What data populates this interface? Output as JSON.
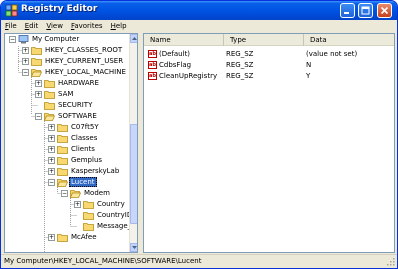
{
  "window": {
    "title": "Registry Editor"
  },
  "menu": {
    "items": [
      {
        "accel": "F",
        "rest": "ile"
      },
      {
        "accel": "E",
        "rest": "dit"
      },
      {
        "accel": "V",
        "rest": "iew"
      },
      {
        "accel": "F",
        "rest": "avorites"
      },
      {
        "accel": "H",
        "rest": "elp"
      }
    ]
  },
  "tree": {
    "root": "My Computer",
    "hkcr": "HKEY_CLASSES_ROOT",
    "hkcu": "HKEY_CURRENT_USER",
    "hklm": "HKEY_LOCAL_MACHINE",
    "hardware": "HARDWARE",
    "sam": "SAM",
    "security": "SECURITY",
    "software": "SOFTWARE",
    "c07ft5y": "C07ft5Y",
    "classes": "Classes",
    "clients": "Clients",
    "gemplus": "Gemplus",
    "kaspersky": "KasperskyLab",
    "lucent": "Lucent",
    "modem": "Modem",
    "country": "Country",
    "countryid": "CountryID",
    "message": "Message_I",
    "mcafee": "McAfee"
  },
  "list": {
    "headers": {
      "name": "Name",
      "type": "Type",
      "data": "Data"
    },
    "rows": [
      {
        "name": "(Default)",
        "type": "REG_SZ",
        "data": "(value not set)"
      },
      {
        "name": "CdbsFlag",
        "type": "REG_SZ",
        "data": "N"
      },
      {
        "name": "CleanUpRegistry",
        "type": "REG_SZ",
        "data": "Y"
      }
    ]
  },
  "status": {
    "path": "My Computer\\HKEY_LOCAL_MACHINE\\SOFTWARE\\Lucent"
  },
  "colors": {
    "selection": "#316AC5",
    "title_bar": "#0055E5",
    "chrome": "#ECE9D8"
  }
}
